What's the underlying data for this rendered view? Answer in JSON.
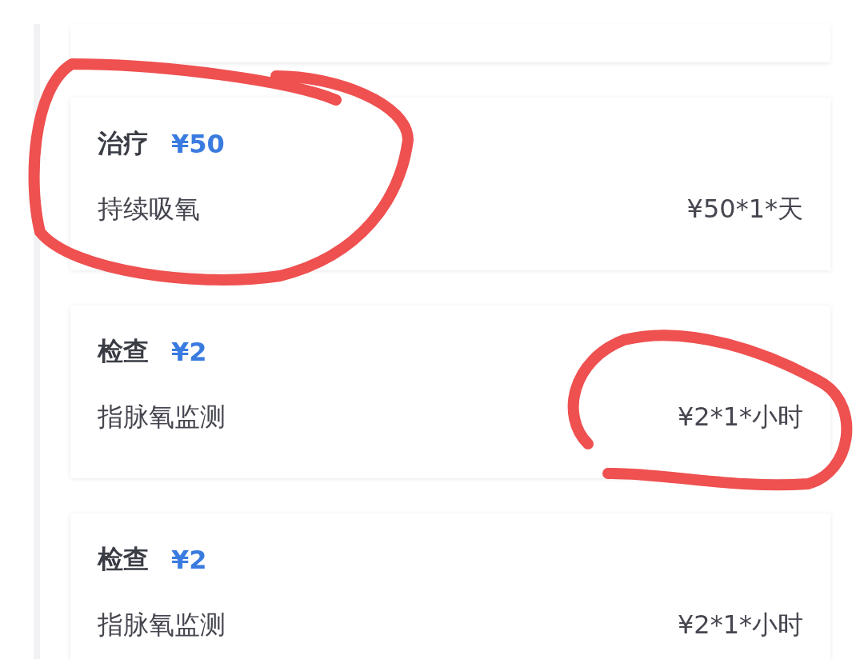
{
  "items": [
    {
      "category": "治疗",
      "price": "¥50",
      "name": "持续吸氧",
      "detail": "¥50*1*天"
    },
    {
      "category": "检查",
      "price": "¥2",
      "name": "指脉氧监测",
      "detail": "¥2*1*小时"
    },
    {
      "category": "检查",
      "price": "¥2",
      "name": "指脉氧监测",
      "detail": "¥2*1*小时"
    }
  ]
}
